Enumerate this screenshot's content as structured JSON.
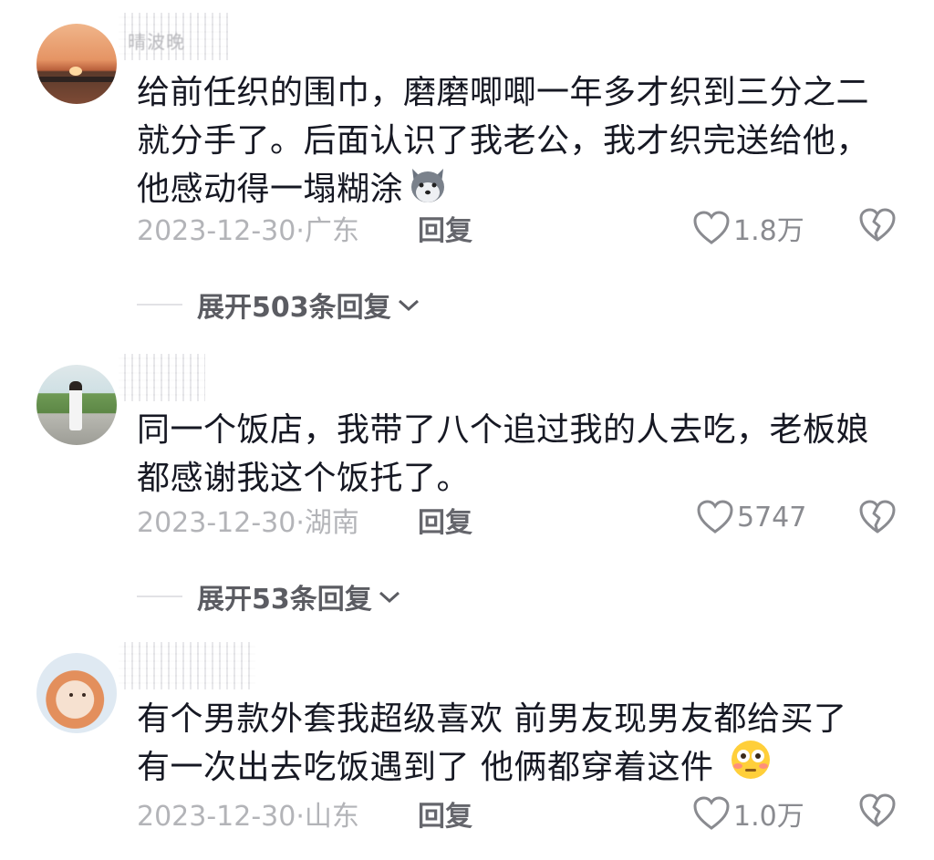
{
  "comments": [
    {
      "username": "晴波晚",
      "text": "给前任织的围巾，磨磨唧唧一年多才织到三分之二就分手了。后面认识了我老公，我才织完送给他，他感动得一塌糊涂",
      "date": "2023-12-30",
      "location": "广东",
      "reply_label": "回复",
      "likes": "1.8万",
      "expand_label": "展开503条回复",
      "emoji": "wolf-face-emoji"
    },
    {
      "username": "",
      "text": "同一个饭店，我带了八个追过我的人去吃，老板娘都感谢我这个饭托了。",
      "date": "2023-12-30",
      "location": "湖南",
      "reply_label": "回复",
      "likes": "5747",
      "expand_label": "展开53条回复"
    },
    {
      "username": "",
      "text": "有个男款外套我超级喜欢 前男友现男友都给买了有一次出去吃饭遇到了 他俩都穿着这件",
      "date": "2023-12-30",
      "location": "山东",
      "reply_label": "回复",
      "likes": "1.0万",
      "emoji": "flushed-face-emoji"
    }
  ],
  "separator": "·",
  "colors": {
    "text": "#161823",
    "meta": "#b3b4b8",
    "action": "#65666c"
  }
}
